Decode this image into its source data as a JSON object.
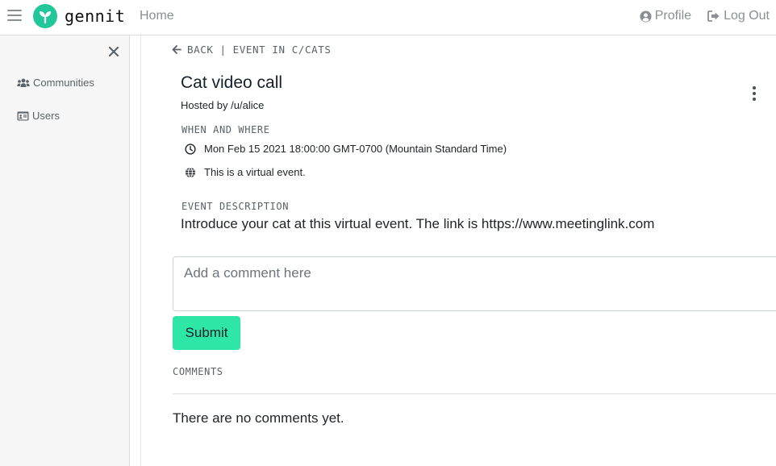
{
  "navbar": {
    "brand": "gennit",
    "home_label": "Home",
    "profile_label": "Profile",
    "logout_label": "Log Out",
    "accent_color": "#21c79a",
    "icons": [
      "hamburger-icon",
      "sprout-logo",
      "user-circle-icon",
      "sign-out-icon"
    ]
  },
  "sidebar": {
    "items": [
      {
        "label": "Communities",
        "icon": "users-icon"
      },
      {
        "label": "Users",
        "icon": "id-card-icon"
      }
    ],
    "close_icon": "close-icon"
  },
  "event": {
    "back_label": "BACK",
    "separator": "|",
    "context_label": "EVENT IN C/CATS",
    "title": "Cat video call",
    "hosted_prefix": "Hosted by",
    "host": "/u/alice",
    "when_where_label": "WHEN AND WHERE",
    "datetime": "Mon Feb 15 2021 18:00:00 GMT-0700 (Mountain Standard Time)",
    "location": "This is a virtual event.",
    "description_label": "EVENT DESCRIPTION",
    "description": "Introduce your cat at this virtual event. The link is https://www.meetinglink.com"
  },
  "comments": {
    "input_placeholder": "Add a comment here",
    "submit_label": "Submit",
    "submit_color": "#2ee6a6",
    "section_label": "COMMENTS",
    "empty_text": "There are no comments yet."
  }
}
